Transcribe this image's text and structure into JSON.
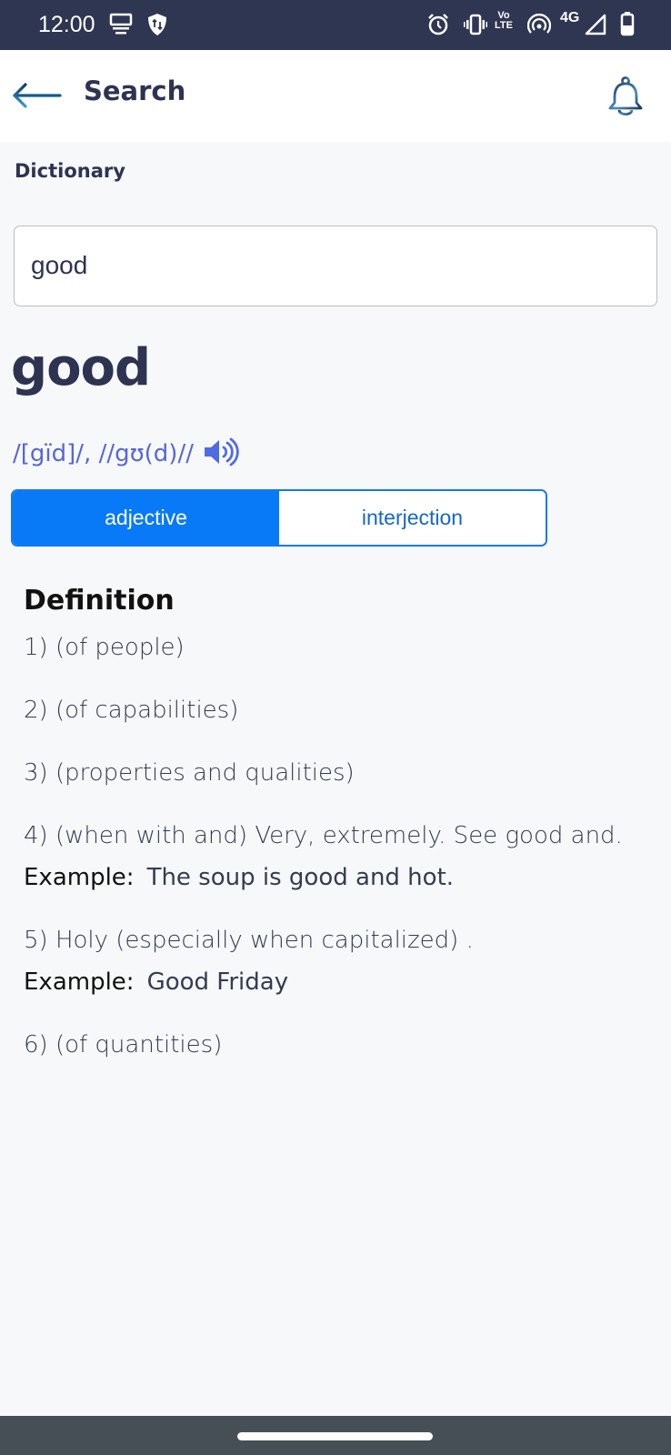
{
  "status_bar": {
    "time": "12:00",
    "left_icons": [
      "notification-stack-icon",
      "vpn-shield-icon"
    ],
    "right_icons": [
      "alarm-icon",
      "vibrate-icon",
      "volte-icon",
      "hotspot-icon",
      "network-4g-icon",
      "signal-icon",
      "battery-icon"
    ],
    "volte_label_top": "Vo",
    "volte_label_bottom": "LTE",
    "network_label": "4G"
  },
  "app_bar": {
    "title": "Search",
    "back_icon": "arrow-left-icon",
    "bell_icon": "bell-icon"
  },
  "section": {
    "label": "Dictionary"
  },
  "search": {
    "value": "good",
    "placeholder": ""
  },
  "entry": {
    "word": "good",
    "phonetic": "/[gïd]/, //gʊ(d)//",
    "speaker_icon": "speaker-icon",
    "parts_of_speech": [
      {
        "label": "adjective",
        "selected": true
      },
      {
        "label": "interjection",
        "selected": false
      }
    ],
    "definition_heading": "Definition",
    "example_label": "Example:",
    "definitions": [
      {
        "text": "1) (of people)",
        "example": null
      },
      {
        "text": "2) (of capabilities)",
        "example": null
      },
      {
        "text": "3) (properties and qualities)",
        "example": null
      },
      {
        "text": "4) (when with and) Very, extremely. See good and.",
        "example": "The soup is good and hot."
      },
      {
        "text": "5) Holy (especially when capitalized) .",
        "example": "Good Friday"
      },
      {
        "text": "6) (of quantities)",
        "example": null
      }
    ]
  },
  "colors": {
    "accent": "#087af8",
    "phonetic": "#5867d6",
    "title_text": "#2d3350",
    "status_bar": "#2f3652",
    "nav_bar": "#474f56"
  }
}
